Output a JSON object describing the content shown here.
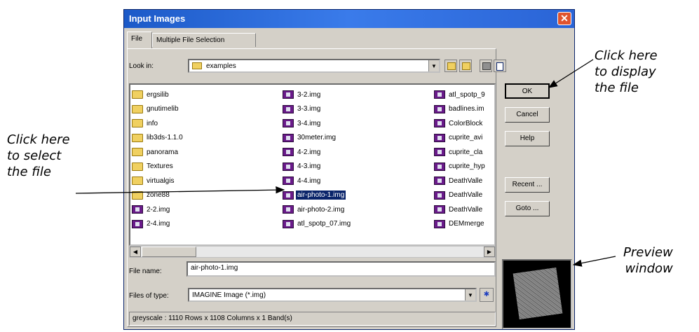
{
  "window": {
    "title": "Input Images",
    "close_icon": "close-icon"
  },
  "tabs": [
    {
      "label": "File",
      "active": true
    },
    {
      "label": "Multiple File Selection",
      "active": false
    }
  ],
  "look_in": {
    "label": "Look in:",
    "value": "examples"
  },
  "toolbar_icons": [
    "up-folder-icon",
    "new-folder-icon",
    "network-icon",
    "file-info-icon"
  ],
  "files": {
    "col1": [
      {
        "name": "ergsilib",
        "type": "folder"
      },
      {
        "name": "gnutimelib",
        "type": "folder"
      },
      {
        "name": "info",
        "type": "folder"
      },
      {
        "name": "lib3ds-1.1.0",
        "type": "folder"
      },
      {
        "name": "panorama",
        "type": "folder"
      },
      {
        "name": "Textures",
        "type": "folder"
      },
      {
        "name": "virtualgis",
        "type": "folder"
      },
      {
        "name": "zone88",
        "type": "folder"
      },
      {
        "name": "2-2.img",
        "type": "image"
      },
      {
        "name": "2-4.img",
        "type": "image"
      }
    ],
    "col2": [
      {
        "name": "3-2.img",
        "type": "image"
      },
      {
        "name": "3-3.img",
        "type": "image"
      },
      {
        "name": "3-4.img",
        "type": "image"
      },
      {
        "name": "30meter.img",
        "type": "image"
      },
      {
        "name": "4-2.img",
        "type": "image"
      },
      {
        "name": "4-3.img",
        "type": "image"
      },
      {
        "name": "4-4.img",
        "type": "image"
      },
      {
        "name": "air-photo-1.img",
        "type": "image",
        "selected": true
      },
      {
        "name": "air-photo-2.img",
        "type": "image"
      },
      {
        "name": "atl_spotp_07.img",
        "type": "image"
      }
    ],
    "col3": [
      {
        "name": "atl_spotp_9",
        "type": "image"
      },
      {
        "name": "badlines.im",
        "type": "image"
      },
      {
        "name": "ColorBlock",
        "type": "image"
      },
      {
        "name": "cuprite_avi",
        "type": "image"
      },
      {
        "name": "cuprite_cla",
        "type": "image"
      },
      {
        "name": "cuprite_hyp",
        "type": "image"
      },
      {
        "name": "DeathValle",
        "type": "image"
      },
      {
        "name": "DeathValle",
        "type": "image"
      },
      {
        "name": "DeathValle",
        "type": "image"
      },
      {
        "name": "DEMmerge",
        "type": "image"
      }
    ]
  },
  "file_name": {
    "label": "File name:",
    "value": "air-photo-1.img"
  },
  "files_of_type": {
    "label": "Files of type:",
    "value": "IMAGINE Image (*.img)"
  },
  "buttons": {
    "ok": "OK",
    "cancel": "Cancel",
    "help": "Help",
    "recent": "Recent ...",
    "goto": "Goto ..."
  },
  "status": "greyscale : 1110 Rows x 1108 Columns x 1 Band(s)",
  "annotations": {
    "display": "Click here\nto display\nthe file",
    "select": "Click here\nto select\nthe file",
    "preview": "Preview\nwindow"
  }
}
